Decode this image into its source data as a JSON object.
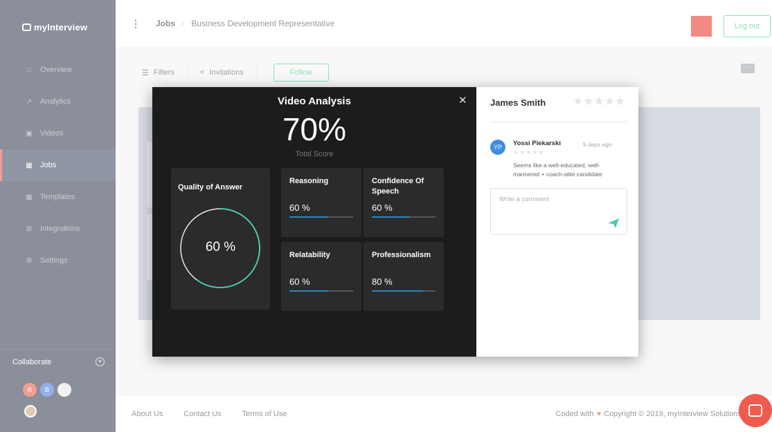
{
  "brand": {
    "name": "myInterview"
  },
  "sidebar": {
    "items": [
      {
        "label": "Overview",
        "icon": "□"
      },
      {
        "label": "Analytics",
        "icon": "↗"
      },
      {
        "label": "Videos",
        "icon": "▣"
      },
      {
        "label": "Jobs",
        "icon": "▦"
      },
      {
        "label": "Templates",
        "icon": "▦"
      },
      {
        "label": "Integrations",
        "icon": "⊞"
      },
      {
        "label": "Settings",
        "icon": "⚙"
      }
    ],
    "collaborate_label": "Collaborate",
    "collaborators": [
      {
        "initial": "R",
        "color": "#e94b3c"
      },
      {
        "initial": "B",
        "color": "#3d6ee0"
      },
      {
        "initial": "",
        "color": "#e6e6e6"
      }
    ]
  },
  "header": {
    "crumb_root": "Jobs",
    "crumb_current": "Business Development Representative",
    "logout_label": "Log out",
    "accent_color": "#2ecc71"
  },
  "toolbar": {
    "filters_label": "Filters",
    "invitations_label": "Invitations",
    "follow_label": "Follow",
    "more_label": "···"
  },
  "modal": {
    "title": "Video Analysis",
    "total_score": "70%",
    "total_label": "Total Score",
    "quality": {
      "label": "Quality of Answer",
      "value_text": "60 %",
      "value": 0.6
    },
    "metrics": [
      {
        "label": "Reasoning",
        "value_text": "60 %",
        "value": 0.6
      },
      {
        "label": "Confidence Of Speech",
        "value_text": "60 %",
        "value": 0.6
      },
      {
        "label": "Relatability",
        "value_text": "60 %",
        "value": 0.6
      },
      {
        "label": "Professionalism",
        "value_text": "80 %",
        "value": 0.8
      }
    ],
    "candidate_name": "James Smith",
    "candidate_stars": "★★★★★",
    "review": {
      "initials": "YP",
      "author": "Yossi Piekarski",
      "time": "9 days ago",
      "stars": "★★★★★",
      "text": "Seems like a well-educated, well-mannered + coach-able candidate"
    },
    "comment_placeholder": "Write a comment"
  },
  "footer": {
    "links": [
      "About Us",
      "Contact Us",
      "Terms of Use"
    ],
    "coded_with": "Coded with",
    "copyright": "Copyright © 2019, myInterview Solutions"
  }
}
